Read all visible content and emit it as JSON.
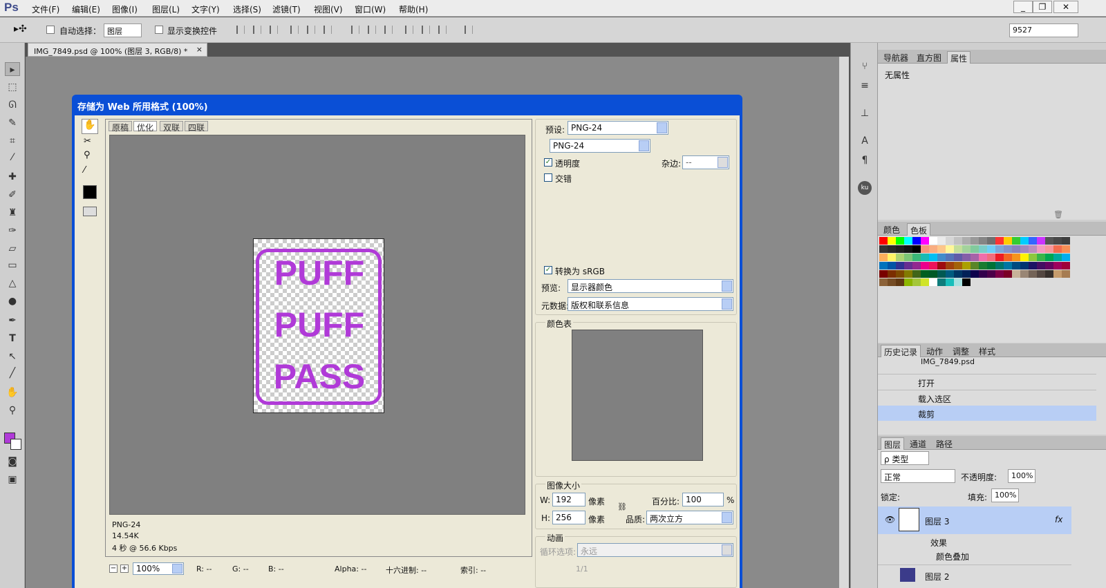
{
  "app": {
    "logo": "Ps"
  },
  "menu": [
    "文件(F)",
    "编辑(E)",
    "图像(I)",
    "图层(L)",
    "文字(Y)",
    "选择(S)",
    "滤镜(T)",
    "视图(V)",
    "窗口(W)",
    "帮助(H)"
  ],
  "window_controls": [
    "_",
    "❐",
    "✕"
  ],
  "options": {
    "auto_select_label": "自动选择：",
    "layer_select": "图层",
    "show_transform_label": "显示变换控件",
    "right_value": "9527"
  },
  "document": {
    "tab_title": "IMG_7849.psd @ 100% (图层 3, RGB/8) *",
    "tab_close": "×"
  },
  "dialog": {
    "title": "存储为 Web 所用格式 (100%)",
    "view_tabs": [
      "原稿",
      "优化",
      "双联",
      "四联"
    ],
    "active_tab": "优化",
    "image_text": [
      "PUFF",
      "PUFF",
      "PASS"
    ],
    "image_color": "#b03ad8",
    "info": {
      "format": "PNG-24",
      "size": "14.54K",
      "speed": "4 秒 @ 56.6 Kbps"
    },
    "zoom": "100%",
    "status": {
      "r": "R: --",
      "g": "G: --",
      "b": "B: --",
      "alpha": "Alpha: --",
      "hex": "十六进制: --",
      "index": "索引: --"
    },
    "preset_label": "预设:",
    "preset_value": "PNG-24",
    "format_value": "PNG-24",
    "transparency_label": "透明度",
    "matte_label": "杂边:",
    "matte_value": "--",
    "interlaced_label": "交错",
    "srgb_label": "转换为 sRGB",
    "preview_label": "预览:",
    "preview_value": "显示器颜色",
    "metadata_label": "元数据:",
    "metadata_value": "版权和联系信息",
    "color_table_label": "颜色表",
    "image_size_label": "图像大小",
    "w_label": "W:",
    "w_value": "192",
    "h_label": "H:",
    "h_value": "256",
    "unit": "像素",
    "percent_label": "百分比:",
    "percent_value": "100",
    "percent_sign": "%",
    "quality_label": "品质:",
    "quality_value": "两次立方",
    "animation_label": "动画",
    "loop_label": "循环选项:",
    "loop_value": "永远",
    "frame_counter": "1/1"
  },
  "right_panels": {
    "top_tabs": [
      "导航器",
      "直方图",
      "属性"
    ],
    "properties_text": "无属性",
    "swatch_tabs": [
      "颜色",
      "色板"
    ],
    "history_tabs": [
      "历史记录",
      "动作",
      "调整",
      "样式"
    ],
    "history_snapshot": "IMG_7849.psd",
    "history_items": [
      "打开",
      "载入选区",
      "裁剪"
    ],
    "layer_tabs": [
      "图层",
      "通道",
      "路径"
    ],
    "filter_label": "ρ 类型",
    "blend_mode": "正常",
    "opacity_label": "不透明度:",
    "opacity_value": "100%",
    "lock_label": "锁定:",
    "fill_label": "填充:",
    "fill_value": "100%",
    "layers": [
      "图层 3",
      "图层 2"
    ],
    "effects_label": "效果",
    "effect_item": "颜色叠加",
    "fx": "fx"
  },
  "colors": {
    "foreground": "#b03ad8",
    "background": "#ffffff",
    "dialog_title": "#0a4fd6",
    "accent": "#b8cef5"
  },
  "swatches": [
    "#ff0000",
    "#ffff00",
    "#00ff00",
    "#00ffff",
    "#0000ff",
    "#ff00ff",
    "#ffffff",
    "#ebebeb",
    "#d6d6d6",
    "#c2c2c2",
    "#adadad",
    "#999999",
    "#858585",
    "#707070",
    "#ff3333",
    "#ffcc00",
    "#33cc33",
    "#00ccff",
    "#3366ff",
    "#cc33ff",
    "#555555",
    "#484848",
    "#3d3d3d",
    "#333333",
    "#292929",
    "#1f1f1f",
    "#141414",
    "#000000",
    "#f7977a",
    "#f9ad81",
    "#fdc68a",
    "#fff79a",
    "#c4df9b",
    "#a3d39c",
    "#82ca9d",
    "#7bcdc8",
    "#6ecff6",
    "#7ea7d8",
    "#8493ca",
    "#8882be",
    "#a187be",
    "#bc8dbf",
    "#f49ac2",
    "#f6989d",
    "#f26c4f",
    "#f68e55",
    "#fbaf5c",
    "#fff467",
    "#acd372",
    "#7cc576",
    "#3bb878",
    "#1abbb4",
    "#00bff3",
    "#438cca",
    "#5574b9",
    "#605ca8",
    "#855fa8",
    "#a763a8",
    "#f06eaa",
    "#f26d7d",
    "#ed1c24",
    "#f26522",
    "#f7941d",
    "#fff200",
    "#8dc73f",
    "#39b54a",
    "#00a651",
    "#00a99d",
    "#00aeef",
    "#0072bc",
    "#0054a6",
    "#2e3192",
    "#662d91",
    "#92278f",
    "#ec008c",
    "#ed145b",
    "#9e0b0f",
    "#a0410d",
    "#a36209",
    "#aba000",
    "#598527",
    "#197b30",
    "#007236",
    "#00746b",
    "#0076a3",
    "#004b80",
    "#003471",
    "#1b1464",
    "#440e62",
    "#630460",
    "#9e005d",
    "#9e0039",
    "#790000",
    "#7b2e00",
    "#7d4900",
    "#827b00",
    "#406618",
    "#005e20",
    "#005826",
    "#005952",
    "#005b7f",
    "#003663",
    "#002157",
    "#0d004c",
    "#32004b",
    "#4b0049",
    "#7b0046",
    "#7a0026",
    "#c7b299",
    "#998675",
    "#736357",
    "#534741",
    "#37302c",
    "#c69c6d",
    "#a67c52",
    "#8c6239",
    "#754c24",
    "#603913",
    "#8db600",
    "#a4c639",
    "#d0e429",
    "#ffffff",
    "#0e7c7b",
    "#17bebb",
    "#a6e1e0",
    "#000000"
  ]
}
